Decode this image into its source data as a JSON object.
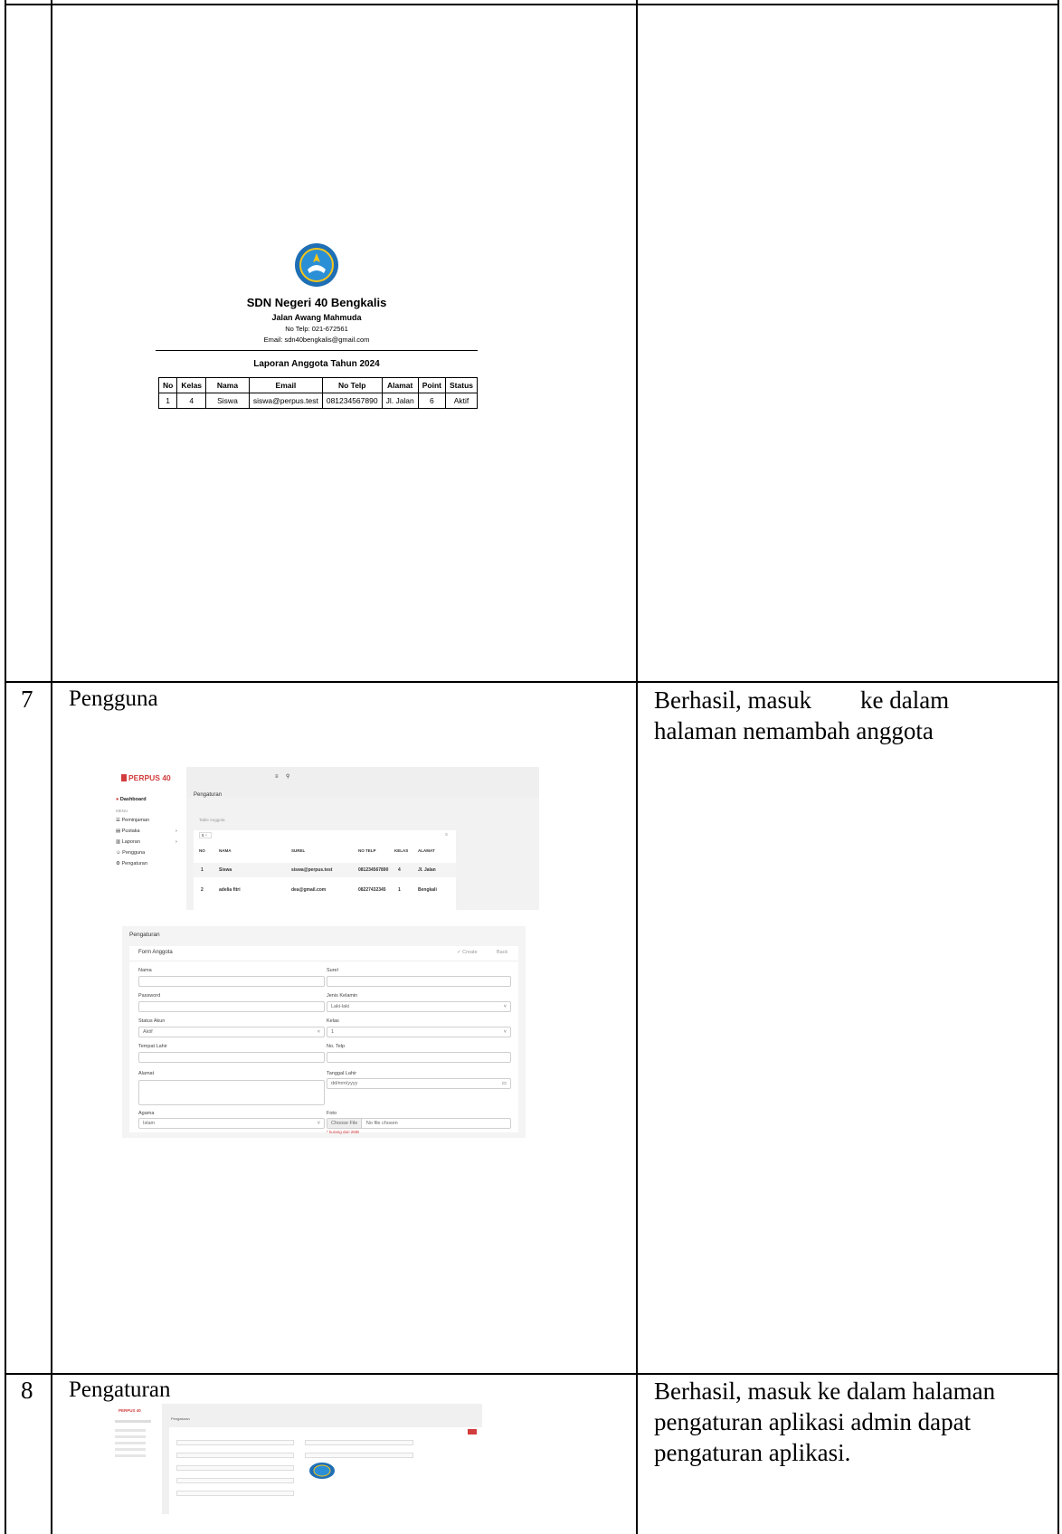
{
  "rows": [
    {
      "number": "",
      "title": "",
      "result_lines": []
    },
    {
      "number": "7",
      "title": "Pengguna",
      "result_lines": [
        "Berhasil, masuk        ke dalam",
        "halaman nemambah anggota"
      ]
    },
    {
      "number": "8",
      "title": "Pengaturan",
      "result_lines": [
        "Berhasil, masuk ke dalam halaman",
        "pengaturan aplikasi admin dapat",
        "pengaturan aplikasi."
      ]
    }
  ],
  "report": {
    "school": "SDN Negeri 40 Bengkalis",
    "street": "Jalan Awang Mahmuda",
    "phone": "No Telp: 021-672561",
    "email": "Email: sdn40bengkalis@gmail.com",
    "title": "Laporan Anggota Tahun 2024",
    "columns": [
      "No",
      "Kelas",
      "Nama",
      "Email",
      "No Telp",
      "Alamat",
      "Point",
      "Status"
    ],
    "rows": [
      [
        "1",
        "4",
        "Siswa",
        "siswa@perpus.test",
        "081234567890",
        "Jl. Jalan",
        "6",
        "Aktif"
      ]
    ]
  },
  "app": {
    "brand": "PERPUS 40",
    "nav": [
      "Dashboard",
      "MENU",
      "Peminjaman",
      "Pustaka",
      "Laporan",
      "Pengguna",
      "Pengaturan"
    ],
    "page_title": "Pengaturan",
    "card_title": "Table Anggota",
    "page_size": "5",
    "search_hint": "S",
    "columns": [
      "NO",
      "NAMA",
      "SUREL",
      "NO TELP",
      "KELAS",
      "ALAMAT"
    ],
    "rows": [
      [
        "1",
        "Siswa",
        "siswa@perpus.test",
        "081234567890",
        "4",
        "Jl. Jalan"
      ],
      [
        "2",
        "adelia fitri",
        "dea@gmail.com",
        "08227432345",
        "1",
        "Bengkali"
      ]
    ]
  },
  "form": {
    "page_title": "Pengaturan",
    "card_title": "Form Anggota",
    "create_label": "✓ Create",
    "back_label": "Back",
    "fields": {
      "nama": {
        "label": "Nama",
        "value": ""
      },
      "surel": {
        "label": "Surel",
        "value": ""
      },
      "password": {
        "label": "Password",
        "value": ""
      },
      "jenis_kelamin": {
        "label": "Jenis Kelamin",
        "value": "Laki-laki"
      },
      "status_akun": {
        "label": "Status Akun",
        "value": "Aktif"
      },
      "kelas": {
        "label": "Kelas",
        "value": "1"
      },
      "tempat_lahir": {
        "label": "Tempat Lahir",
        "value": ""
      },
      "no_telp": {
        "label": "No. Telp",
        "value": ""
      },
      "alamat": {
        "label": "Alamat",
        "value": ""
      },
      "tanggal_lahir": {
        "label": "Tanggal Lahir",
        "value": "dd/mm/yyyy"
      },
      "agama": {
        "label": "Agama",
        "value": "Islam"
      },
      "foto": {
        "label": "Foto",
        "button": "Choose File",
        "status": "No file chosen",
        "hint": "* kurang dari 2MB"
      }
    }
  },
  "settings": {
    "brand": "PERPUS 40",
    "page_title": "Pengaturan"
  },
  "colors": {
    "brand_red": "#d23c3c",
    "accent_blue": "#1e6fb5"
  }
}
